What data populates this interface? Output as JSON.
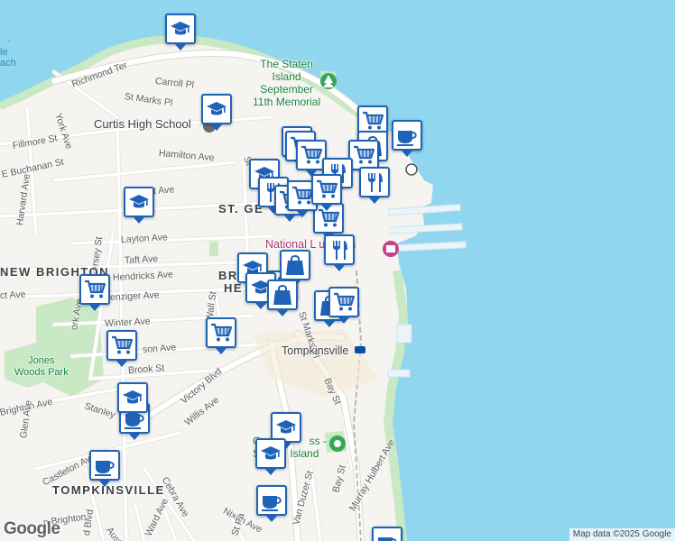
{
  "map": {
    "colors": {
      "water": "#8fd6ee",
      "land": "#f5f4f1",
      "park": "#c8e9c3",
      "road": "#ffffff",
      "roadEdge": "#e2e0dc",
      "marker": "#1f63b8"
    },
    "labels": {
      "water": "le\nach",
      "richmond_ter": "Richmond Ter",
      "carroll_pl": "Carroll Pl",
      "st_marks_pl_n": "St Marks Pl",
      "memorial": "The Staten\nIsland\nSeptember\n11th Memorial",
      "york_ave": "York Ave",
      "curtis": "Curtis High School",
      "fillmore": "Fillmore St",
      "buchanan": "E Buchanan St",
      "hamilton": "Hamilton Ave",
      "st_partial": "St",
      "harvard": "Harvard Ave",
      "st_ave_partial": "t Ave",
      "st_george": "ST. GE",
      "jersey": "Jersey St",
      "layton": "Layton Ave",
      "taft": "Taft Ave",
      "new_brighton": "NEW BRIGHTON",
      "hendricks": "Hendricks Ave",
      "bri": "BRI",
      "he": "HE",
      "museum": "National L     use     um",
      "ct_ave": "ct Ave",
      "benziger": "enziger Ave",
      "york_ave_s": "ork Ave",
      "st_marks_pl_s": "St Marks Pl",
      "winter": "Winter Ave",
      "wall": "Wall St",
      "son_ave": "son Ave",
      "tompkinsville_station": "Tompkinsville",
      "jones_woods": "Jones\nWoods Park",
      "brook": "Brook St",
      "victory": "Victory Blvd",
      "bay_st_n": "Bay St",
      "brighton": "Brighton Ave",
      "stanley": "Stanley",
      "willis": "Willis Ave",
      "glen": "Glen Ave",
      "crum": "Crum          ss -\nS          Island",
      "castleton": "Castleton Ave",
      "cebra": "Cebra Ave",
      "murray": "Murray Hulbert Ave",
      "tompkinsville_district": "TOMPKINSVILLE",
      "bay_st_s": "Bay St",
      "nixon": "Nixon Ave",
      "van_duzer": "Van Duzer St",
      "st_pa": "St Pa",
      "ward": "Ward Ave",
      "austin": "Austin Pl",
      "n_brighton": "n Brighton",
      "dd_blvd": "d Blvd"
    },
    "markers": [
      {
        "icon": "school"
      },
      {
        "icon": "school"
      },
      {
        "icon": "cart"
      },
      {
        "icon": "cart"
      },
      {
        "icon": "bag"
      },
      {
        "icon": "coffee"
      },
      {
        "icon": "coffee"
      },
      {
        "icon": "cart"
      },
      {
        "icon": "school"
      },
      {
        "icon": "cart"
      },
      {
        "icon": "bag"
      },
      {
        "icon": "cart"
      },
      {
        "icon": "cart"
      },
      {
        "icon": "school"
      },
      {
        "icon": "fork"
      },
      {
        "icon": "cart"
      },
      {
        "icon": "cart"
      },
      {
        "icon": "fork"
      },
      {
        "icon": "fork"
      },
      {
        "icon": "cart"
      },
      {
        "icon": "fork"
      },
      {
        "icon": "school"
      },
      {
        "icon": "school"
      },
      {
        "icon": "bag"
      },
      {
        "icon": "bag"
      },
      {
        "icon": "bag"
      },
      {
        "icon": "cart"
      },
      {
        "icon": "cart"
      },
      {
        "icon": "cart"
      },
      {
        "icon": "school"
      },
      {
        "icon": "coffee"
      },
      {
        "icon": "school"
      },
      {
        "icon": "school"
      },
      {
        "icon": "coffee"
      },
      {
        "icon": "coffee"
      },
      {
        "icon": "cart"
      }
    ],
    "attribution": "Map data ©2025 Google",
    "logo": "Google"
  }
}
